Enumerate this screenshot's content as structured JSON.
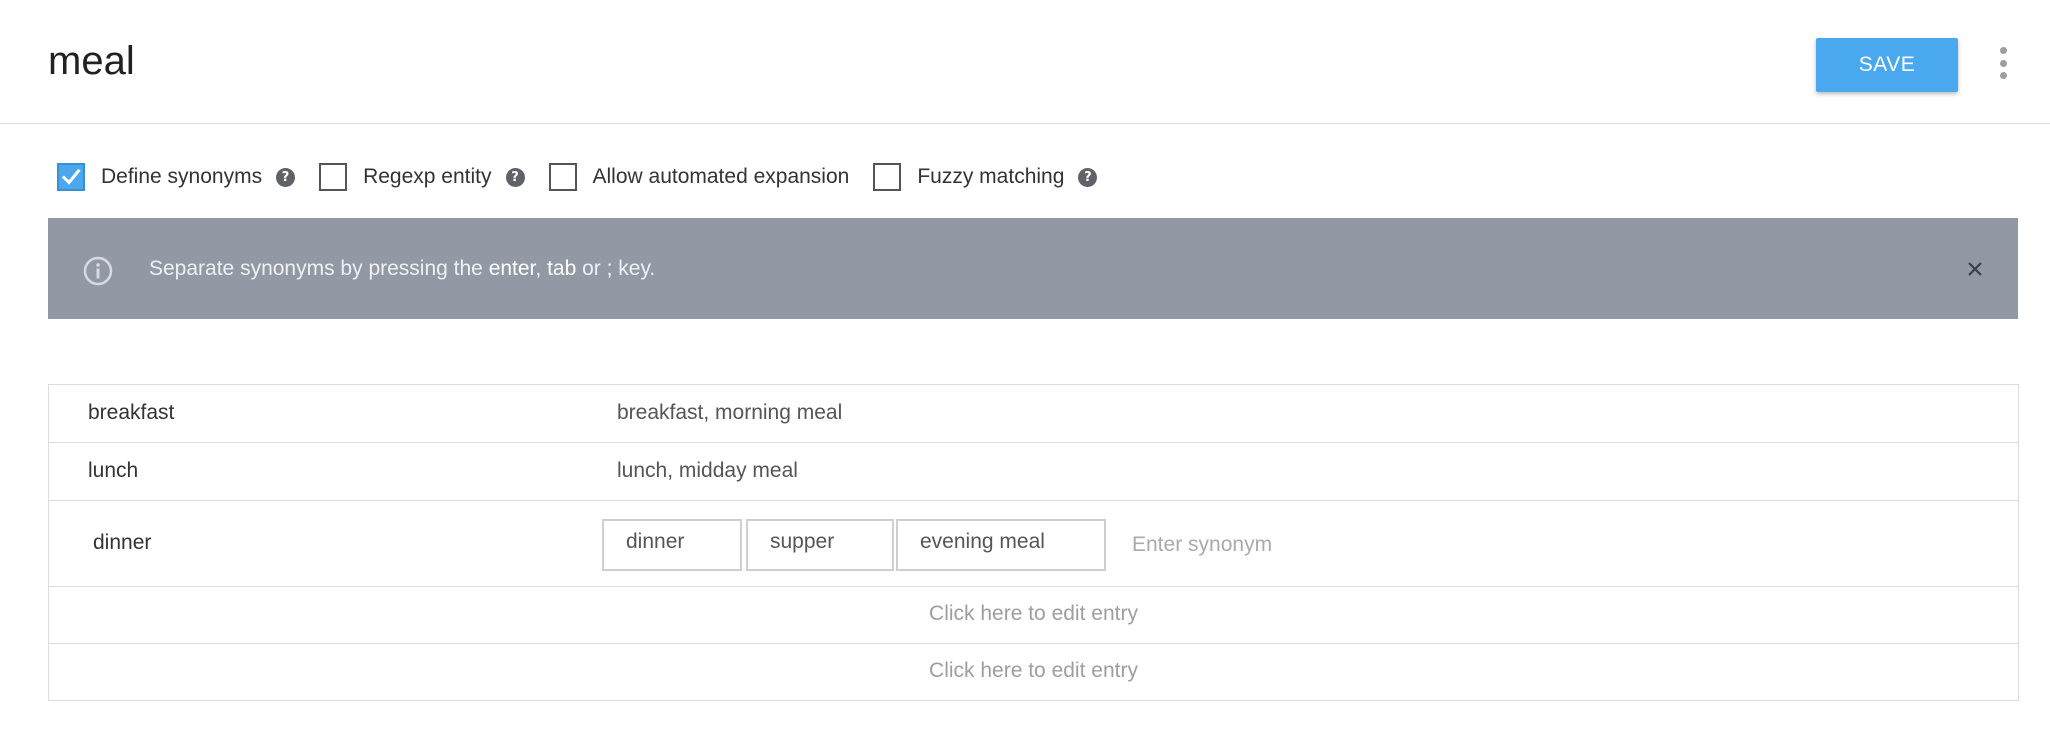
{
  "header": {
    "title": "meal",
    "save_label": "SAVE",
    "more_menu_icon": "more-vert-icon"
  },
  "options": [
    {
      "label": "Define synonyms",
      "checked": true,
      "has_help": true
    },
    {
      "label": "Regexp entity",
      "checked": false,
      "has_help": true
    },
    {
      "label": "Allow automated expansion",
      "checked": false,
      "has_help": false
    },
    {
      "label": "Fuzzy matching",
      "checked": false,
      "has_help": true
    }
  ],
  "banner": {
    "icon": "info-icon",
    "text_before": "Separate synonyms by pressing the ",
    "key1": "enter",
    "sep1": ", ",
    "key2": "tab",
    "text_middle": " or ",
    "key3": ";",
    "text_after": " key.",
    "close_icon": "close-icon",
    "background": "#9399a4"
  },
  "entries": [
    {
      "reference": "breakfast",
      "synonyms_text": "breakfast, morning meal"
    },
    {
      "reference": "lunch",
      "synonyms_text": "lunch, midday meal"
    },
    {
      "reference": "dinner",
      "synonym_chips": [
        "dinner",
        "supper",
        "evening meal"
      ],
      "input_placeholder": "Enter synonym"
    }
  ],
  "empty_rows": [
    {
      "label": "Click here to edit entry"
    },
    {
      "label": "Click here to edit entry"
    }
  ],
  "colors": {
    "accent": "#4aa9ee",
    "banner": "#9399a4",
    "border": "#dcdcdc",
    "placeholder": "#9e9e9e"
  }
}
